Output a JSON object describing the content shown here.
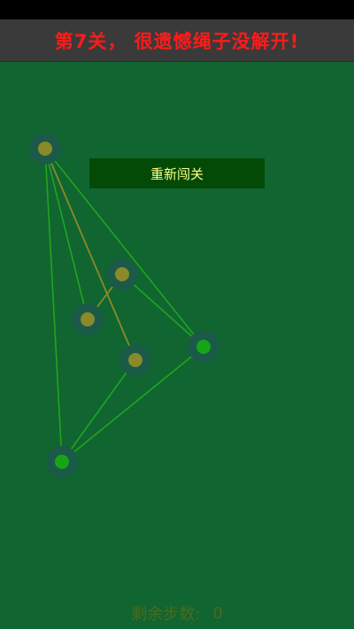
{
  "header": {
    "title": "第7关， 很遗憾绳子没解开!"
  },
  "overlay": {
    "restart_label": "重新闯关"
  },
  "footer": {
    "steps_label": "剩余步数:",
    "steps_value": "0"
  },
  "colors": {
    "background": "#116530",
    "title_text": "#ff1a1a",
    "rope_tangled": "#8a8a2a",
    "rope_free": "#1fa51f",
    "node_ring": "#1b5a48",
    "node_yellow": "#8a8a2a",
    "node_green": "#17a517"
  }
}
